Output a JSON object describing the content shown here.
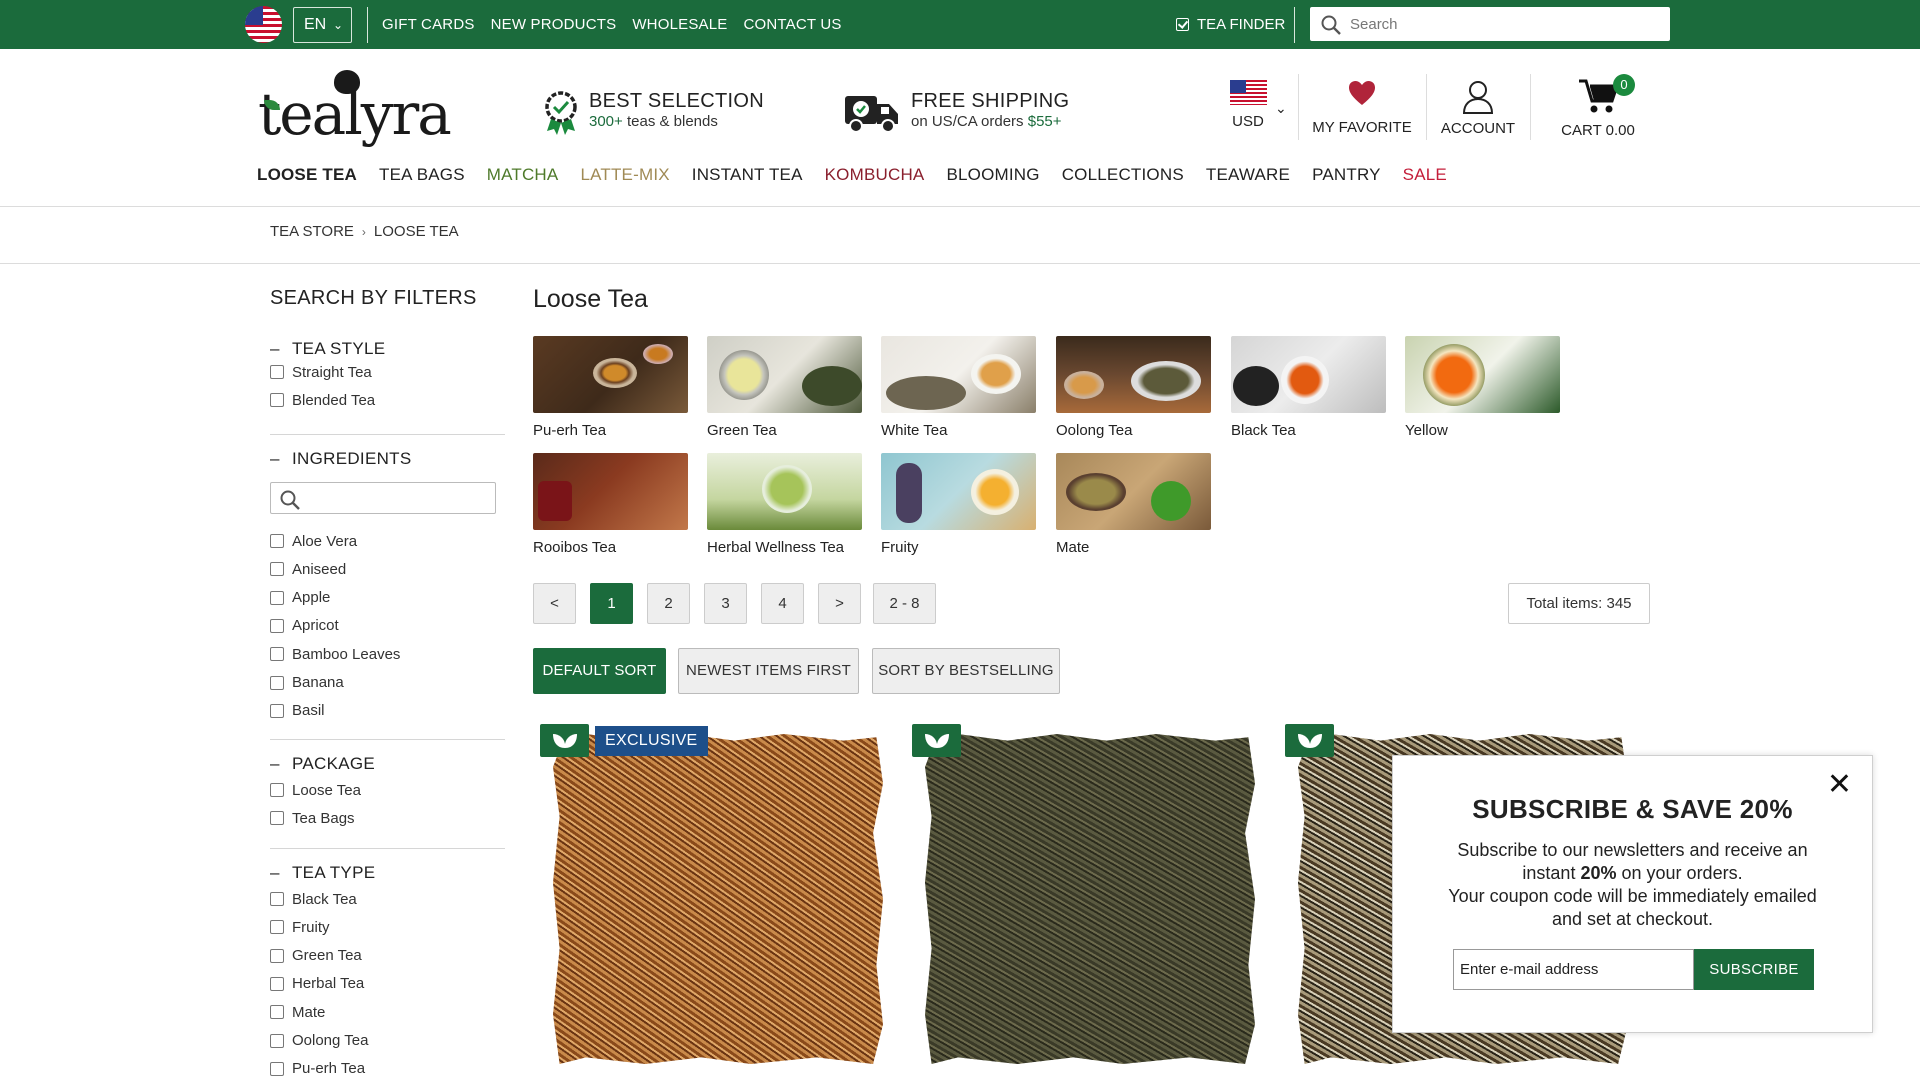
{
  "topbar": {
    "language": "EN",
    "links": [
      "GIFT CARDS",
      "NEW PRODUCTS",
      "WHOLESALE",
      "CONTACT US"
    ],
    "tea_finder": "TEA FINDER",
    "search_placeholder": "Search"
  },
  "header": {
    "logo_text": "tealyra",
    "usp_selection_title": "BEST SELECTION",
    "usp_selection_highlight": "300+",
    "usp_selection_rest": "teas & blends",
    "usp_shipping_title": "FREE SHIPPING",
    "usp_shipping_text": "on US/CA orders",
    "usp_shipping_amount": "$55+",
    "currency": "USD",
    "favorite": "MY FAVORITE",
    "account": "ACCOUNT",
    "cart": "CART 0.00",
    "cart_count": "0"
  },
  "categories": [
    {
      "label": "LOOSE TEA",
      "color": "#222222",
      "bold": true
    },
    {
      "label": "TEA BAGS",
      "color": "#222222"
    },
    {
      "label": "MATCHA",
      "color": "#4e7a2a"
    },
    {
      "label": "LATTE-MIX",
      "color": "#a08a55"
    },
    {
      "label": "INSTANT TEA",
      "color": "#222222"
    },
    {
      "label": "KOMBUCHA",
      "color": "#8a1f2d"
    },
    {
      "label": "BLOOMING",
      "color": "#222222"
    },
    {
      "label": "COLLECTIONS",
      "color": "#222222"
    },
    {
      "label": "TEAWARE",
      "color": "#222222"
    },
    {
      "label": "PANTRY",
      "color": "#222222"
    },
    {
      "label": "SALE",
      "color": "#c41e3a"
    }
  ],
  "breadcrumb": [
    "TEA STORE",
    "LOOSE TEA"
  ],
  "sidebar": {
    "title": "SEARCH BY FILTERS",
    "groups": {
      "tea_style": {
        "title": "TEA STYLE",
        "options": [
          "Straight Tea",
          "Blended Tea"
        ]
      },
      "ingredients": {
        "title": "INGREDIENTS",
        "options": [
          "Aloe Vera",
          "Aniseed",
          "Apple",
          "Apricot",
          "Bamboo Leaves",
          "Banana",
          "Basil"
        ]
      },
      "package": {
        "title": "PACKAGE",
        "options": [
          "Loose Tea",
          "Tea Bags"
        ]
      },
      "tea_type": {
        "title": "TEA TYPE",
        "options": [
          "Black Tea",
          "Fruity",
          "Green Tea",
          "Herbal Tea",
          "Mate",
          "Oolong Tea",
          "Pu-erh Tea"
        ]
      }
    }
  },
  "main": {
    "title": "Loose Tea",
    "tiles": [
      "Pu-erh Tea",
      "Green Tea",
      "White Tea",
      "Oolong Tea",
      "Black Tea",
      "Yellow",
      "Rooibos Tea",
      "Herbal Wellness Tea",
      "Fruity",
      "Mate"
    ],
    "pagination": [
      "<",
      "1",
      "2",
      "3",
      "4",
      ">",
      "2 - 8"
    ],
    "current_page": "1",
    "total_items": "Total items: 345",
    "sort_buttons": [
      "DEFAULT SORT",
      "NEWEST ITEMS FIRST",
      "SORT BY BESTSELLING"
    ],
    "exclusive_badge": "EXCLUSIVE"
  },
  "popup": {
    "title": "SUBSCRIBE & SAVE 20%",
    "line1": "Subscribe to our newsletters and receive an",
    "line2_pre": "instant",
    "line2_bold": "20%",
    "line2_post": "on your orders.",
    "line3": "Your coupon code will be immediately emailed",
    "line4": "and set at checkout.",
    "email_placeholder": "Enter e-mail address",
    "button": "SUBSCRIBE"
  },
  "colors": {
    "brand_green": "#1b6b3c",
    "exclusive_blue": "#1d4f8a",
    "favorite_red": "#b0243a"
  }
}
